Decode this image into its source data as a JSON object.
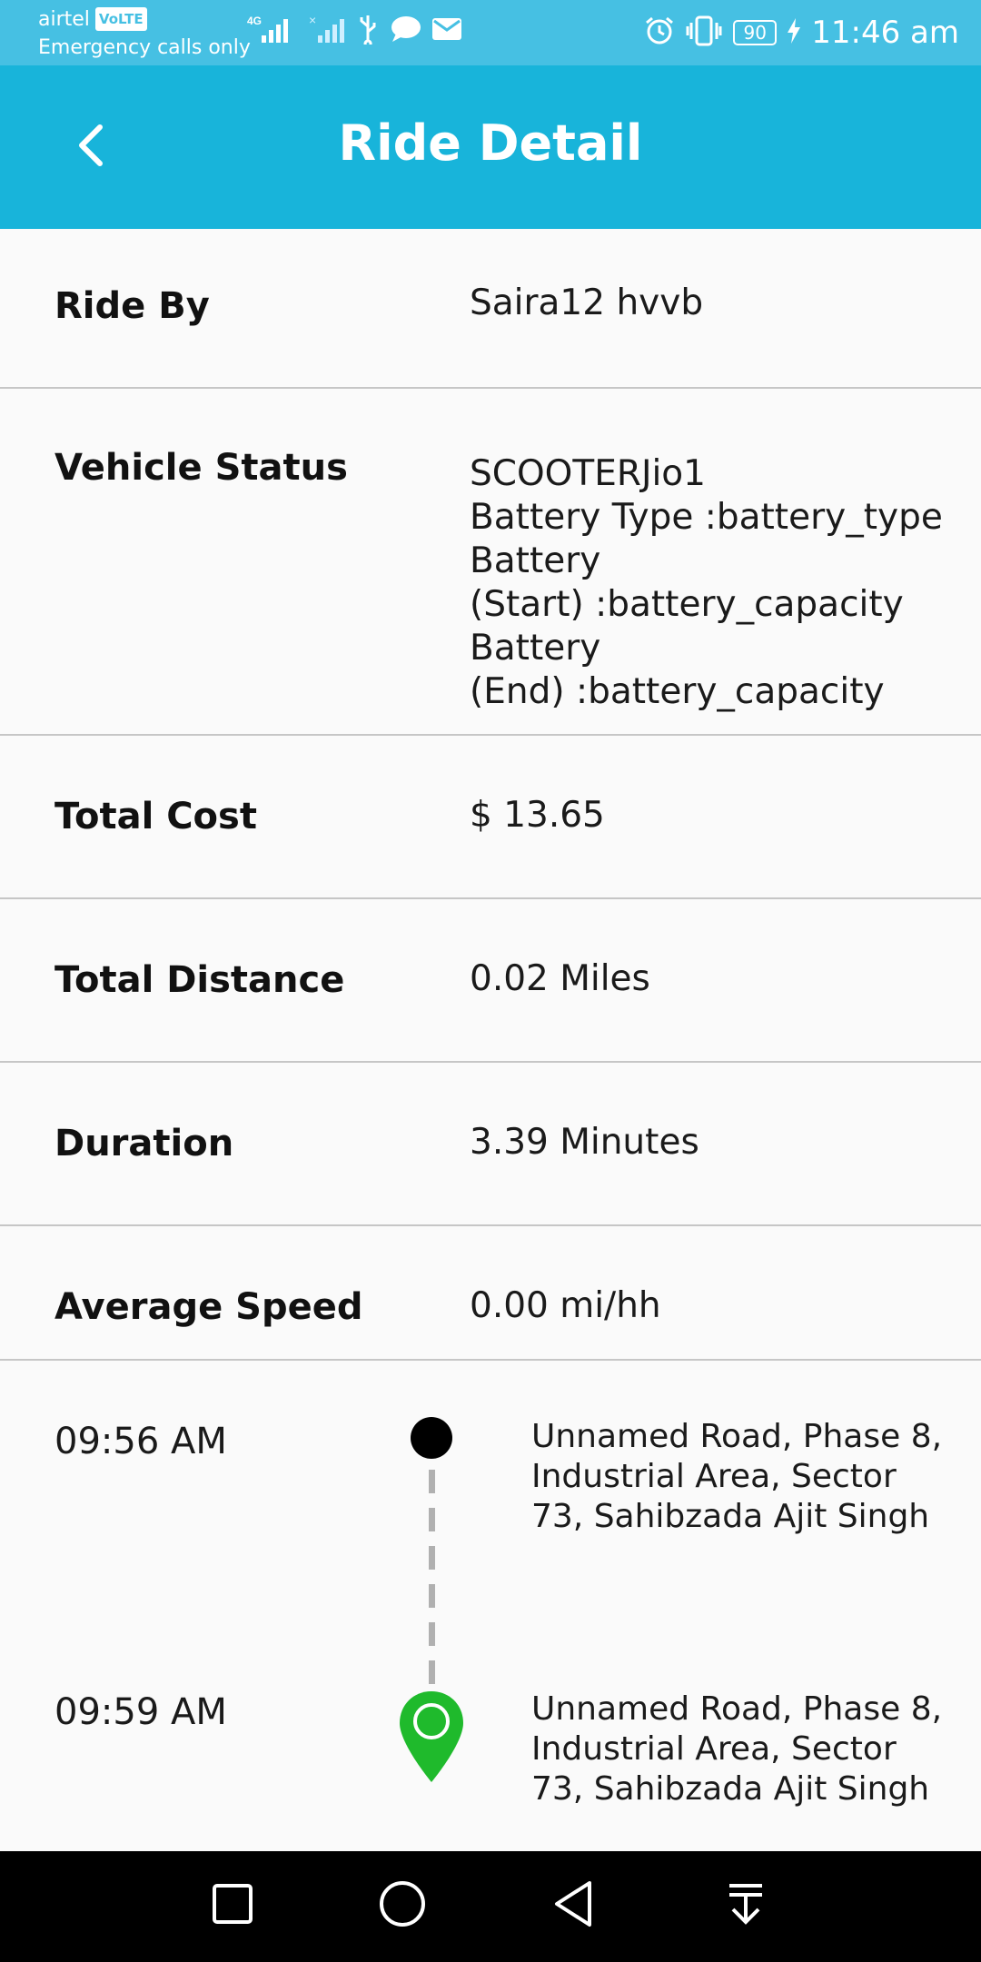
{
  "status_bar": {
    "carrier": "airtel",
    "volte": "VoLTE",
    "emergency": "Emergency calls only",
    "network": "4G",
    "battery": "90",
    "time": "11:46 am"
  },
  "header": {
    "title": "Ride Detail",
    "back_icon": "chevron-left-icon"
  },
  "details": {
    "ride_by": {
      "label": "Ride By",
      "value": "Saira12 hvvb"
    },
    "vehicle_status": {
      "label": "Vehicle Status",
      "lines": [
        "SCOOTERJio1",
        "Battery Type :battery_type",
        "Battery",
        "(Start) :battery_capacity",
        "Battery",
        "(End) :battery_capacity"
      ]
    },
    "total_cost": {
      "label": "Total Cost",
      "value": "$ 13.65"
    },
    "total_distance": {
      "label": "Total Distance",
      "value": "0.02 Miles"
    },
    "duration": {
      "label": "Duration",
      "value": "3.39 Minutes"
    },
    "average_speed": {
      "label": "Average Speed",
      "value": "0.00 mi/hh"
    }
  },
  "timeline": {
    "start": {
      "time": "09:56 AM",
      "address": "Unnamed Road, Phase 8, Industrial Area, Sector 73, Sahibzada Ajit Singh"
    },
    "end": {
      "time": "09:59 AM",
      "address": "Unnamed Road, Phase 8, Industrial Area, Sector 73, Sahibzada Ajit Singh"
    }
  },
  "colors": {
    "app_bar": "#18b4da",
    "status_bar": "#46c0e3",
    "pin_green": "#1fba2c",
    "start_dot": "#000000"
  },
  "nav": {
    "recent_icon": "square-icon",
    "home_icon": "circle-icon",
    "back_icon": "triangle-back-icon",
    "notification_icon": "pull-down-icon"
  }
}
